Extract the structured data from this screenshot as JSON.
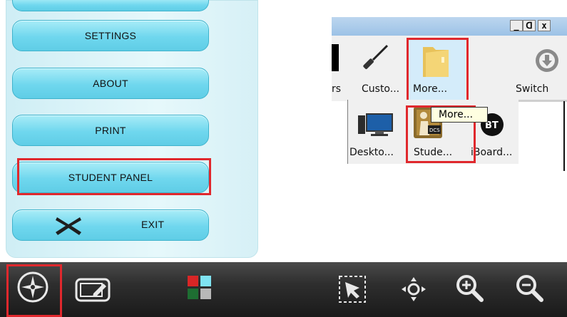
{
  "menu": {
    "items": [
      {
        "label": ""
      },
      {
        "label": "SETTINGS"
      },
      {
        "label": "ABOUT"
      },
      {
        "label": "PRINT"
      },
      {
        "label": "STUDENT PANEL"
      },
      {
        "label": "EXIT"
      }
    ]
  },
  "window": {
    "controls": {
      "minimize": "_",
      "restore": "ᗡ",
      "close": "x"
    },
    "toolbar": [
      {
        "label": "rs",
        "icon": "partial-tool-icon"
      },
      {
        "label": "Custo...",
        "icon": "screwdriver-icon"
      },
      {
        "label": "More...",
        "icon": "folder-icon"
      },
      {
        "label": "Switch",
        "icon": "download-circle-icon"
      }
    ],
    "apps": [
      {
        "label": "Deskto...",
        "icon": "monitor-icon"
      },
      {
        "label": "Stude...",
        "icon": "student-dcs-icon"
      },
      {
        "label": "iBoard...",
        "icon": "iboard-icon"
      }
    ],
    "tooltip": "More..."
  },
  "colors": {
    "highlight": "#e0282d",
    "button": "#6fd7ee",
    "toolbar_bg": "#2e2e2e"
  },
  "bottom_toolbar": [
    {
      "icon": "compass-icon"
    },
    {
      "icon": "edit-box-icon"
    },
    {
      "icon": "color-palette-icon"
    },
    {
      "icon": "marquee-select-icon"
    },
    {
      "icon": "pan-move-icon"
    },
    {
      "icon": "zoom-in-icon"
    },
    {
      "icon": "zoom-out-icon"
    }
  ]
}
